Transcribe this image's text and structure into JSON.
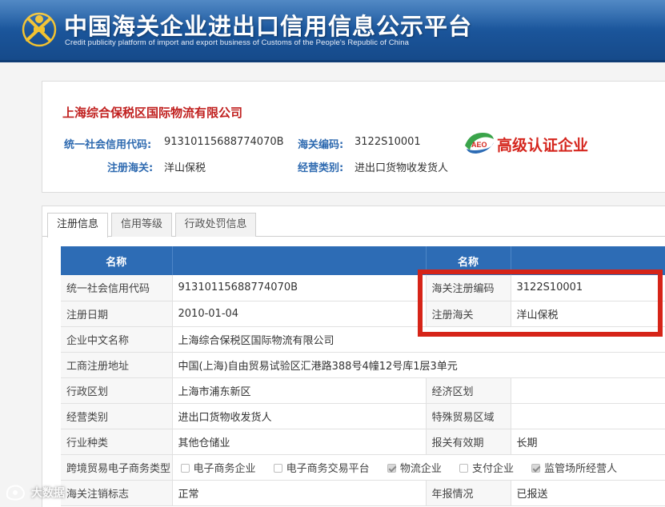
{
  "header": {
    "title": "中国海关企业进出口信用信息公示平台",
    "subtitle": "Credit publicity platform of import and export business of Customs of the People's Republic of China",
    "logo_icon": "customs-emblem-icon"
  },
  "company": {
    "name": "上海综合保税区国际物流有限公司",
    "credit_code_label": "统一社会信用代码:",
    "credit_code": "91310115688774070B",
    "customs_code_label": "海关编码:",
    "customs_code": "3122S10001",
    "reg_customs_label": "注册海关:",
    "reg_customs": "洋山保税",
    "business_type_label": "经营类别:",
    "business_type": "进出口货物收发货人",
    "aeo_logo_text": "AEO",
    "aeo_label": "高级认证企业"
  },
  "tabs": [
    {
      "label": "注册信息",
      "active": true
    },
    {
      "label": "信用等级",
      "active": false
    },
    {
      "label": "行政处罚信息",
      "active": false
    }
  ],
  "table": {
    "headers": [
      "名称",
      "",
      "名称",
      ""
    ],
    "rows": [
      {
        "l1": "统一社会信用代码",
        "v1": "91310115688774070B",
        "l2": "海关注册编码",
        "v2": "3122S10001"
      },
      {
        "l1": "注册日期",
        "v1": "2010-01-04",
        "l2": "注册海关",
        "v2": "洋山保税"
      },
      {
        "l1": "企业中文名称",
        "v1": "上海综合保税区国际物流有限公司"
      },
      {
        "l1": "工商注册地址",
        "v1": "中国(上海)自由贸易试验区汇港路388号4幢12号库1层3单元"
      },
      {
        "l1": "行政区划",
        "v1": "上海市浦东新区",
        "l2": "经济区划",
        "v2": ""
      },
      {
        "l1": "经营类别",
        "v1": "进出口货物收发货人",
        "l2": "特殊贸易区域",
        "v2": ""
      },
      {
        "l1": "行业种类",
        "v1": "其他仓储业",
        "l2": "报关有效期",
        "v2": "长期"
      },
      {
        "l1": "海关注销标志",
        "v1": "正常",
        "l2": "年报情况",
        "v2": "已报送"
      }
    ],
    "ecommerce": {
      "label": "跨境贸易电子商务类型",
      "options": [
        {
          "label": "电子商务企业",
          "checked": false
        },
        {
          "label": "电子商务交易平台",
          "checked": false
        },
        {
          "label": "物流企业",
          "checked": true
        },
        {
          "label": "支付企业",
          "checked": false
        },
        {
          "label": "监管场所经营人",
          "checked": true
        }
      ]
    }
  },
  "watermark": {
    "text": "大数据",
    "icon": "camera-icon"
  },
  "colors": {
    "header_blue": "#1a5499",
    "label_blue": "#2e6ab0",
    "company_red": "#c0201f",
    "table_header": "#2d6cb5",
    "highlight_red": "#d62418"
  }
}
